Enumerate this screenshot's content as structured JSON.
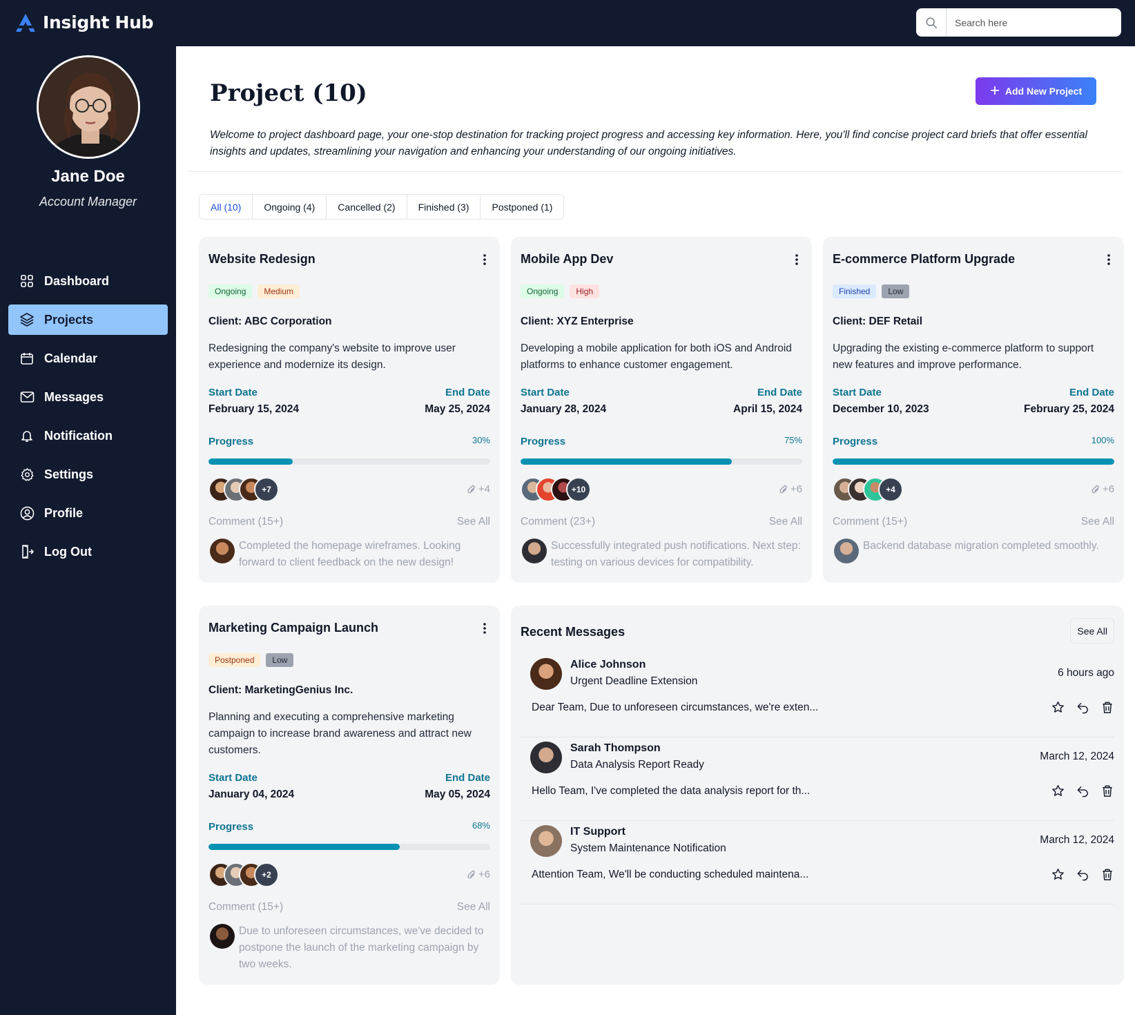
{
  "app": {
    "name": "Insight Hub"
  },
  "search": {
    "placeholder": "Search here"
  },
  "user": {
    "name": "Jane Doe",
    "role": "Account Manager"
  },
  "sidebar": {
    "items": [
      {
        "label": "Dashboard",
        "icon": "grid-icon",
        "active": false
      },
      {
        "label": "Projects",
        "icon": "layers-icon",
        "active": true
      },
      {
        "label": "Calendar",
        "icon": "calendar-icon",
        "active": false
      },
      {
        "label": "Messages",
        "icon": "mail-icon",
        "active": false
      },
      {
        "label": "Notification",
        "icon": "bell-icon",
        "active": false
      },
      {
        "label": "Settings",
        "icon": "gear-icon",
        "active": false
      },
      {
        "label": "Profile",
        "icon": "user-circle-icon",
        "active": false
      },
      {
        "label": "Log Out",
        "icon": "logout-icon",
        "active": false
      }
    ]
  },
  "header": {
    "title": "Project (10)",
    "add_label": "Add New Project",
    "intro": "Welcome to project dashboard page, your one-stop destination for tracking project progress and accessing key information. Here, you'll find concise project card briefs that offer essential insights and updates, streamlining your navigation and enhancing your understanding of our ongoing initiatives."
  },
  "tabs": [
    {
      "label": "All (10)",
      "active": true
    },
    {
      "label": "Ongoing (4)",
      "active": false
    },
    {
      "label": "Cancelled (2)",
      "active": false
    },
    {
      "label": "Finished (3)",
      "active": false
    },
    {
      "label": "Postponed (1)",
      "active": false
    }
  ],
  "labels": {
    "start": "Start Date",
    "end": "End Date",
    "progress": "Progress",
    "see_all": "See All"
  },
  "projects": [
    {
      "title": "Website Redesign",
      "status": "Ongoing",
      "priority": "Medium",
      "client": "Client: ABC Corporation",
      "description": "Redesigning the company's website to improve user experience and modernize its design.",
      "start": "February 15, 2024",
      "end": "May 25, 2024",
      "progress_label": "30%",
      "progress": 0.3,
      "more_members": "+7",
      "attachments": "+4",
      "comment_count": "Comment (15+)",
      "comment": "Completed the homepage wireframes. Looking forward to client feedback on the new design!"
    },
    {
      "title": "Mobile App Dev",
      "status": "Ongoing",
      "priority": "High",
      "client": "Client: XYZ Enterprise",
      "description": "Developing a mobile application for both iOS and Android platforms to enhance customer engagement.",
      "start": "January 28, 2024",
      "end": "April 15, 2024",
      "progress_label": "75%",
      "progress": 0.75,
      "more_members": "+10",
      "attachments": "+6",
      "comment_count": "Comment (23+)",
      "comment": "Successfully integrated push notifications. Next step: testing on various devices for compatibility."
    },
    {
      "title": "E-commerce Platform Upgrade",
      "status": "Finished",
      "priority": "Low",
      "client": "Client: DEF Retail",
      "description": "Upgrading the existing e-commerce platform to support new features and improve performance.",
      "start": "December 10, 2023",
      "end": "February 25, 2024",
      "progress_label": "100%",
      "progress": 1.0,
      "more_members": "+4",
      "attachments": "+6",
      "comment_count": "Comment (15+)",
      "comment": "Backend database migration completed smoothly."
    },
    {
      "title": "Marketing Campaign Launch",
      "status": "Postponed",
      "priority": "Low",
      "client": "Client: MarketingGenius Inc.",
      "description": "Planning and executing a comprehensive marketing campaign to increase brand awareness and attract new customers.",
      "start": "January 04, 2024",
      "end": "May 05, 2024",
      "progress_label": "68%",
      "progress": 0.68,
      "more_members": "+2",
      "attachments": "+6",
      "comment_count": "Comment (15+)",
      "comment": "Due to unforeseen circumstances, we've decided to postpone the launch of the marketing campaign by two weeks."
    }
  ],
  "messages": {
    "title": "Recent Messages",
    "see_all": "See All",
    "items": [
      {
        "name": "Alice Johnson",
        "subject": "Urgent Deadline Extension",
        "time": "6 hours ago",
        "body": "Dear Team, Due to unforeseen circumstances, we're exten..."
      },
      {
        "name": "Sarah Thompson",
        "subject": "Data Analysis Report Ready",
        "time": "March 12, 2024",
        "body": "Hello Team, I've completed the data analysis report for th..."
      },
      {
        "name": "IT Support",
        "subject": "System Maintenance Notification",
        "time": "March 12, 2024",
        "body": "Attention Team, We'll be conducting scheduled maintena..."
      }
    ]
  },
  "colors": {
    "navy": "#111a2e",
    "accent": "#0891b2",
    "active_nav": "#93c5fd",
    "button_from": "#7c3aed",
    "button_to": "#3b82f6"
  }
}
